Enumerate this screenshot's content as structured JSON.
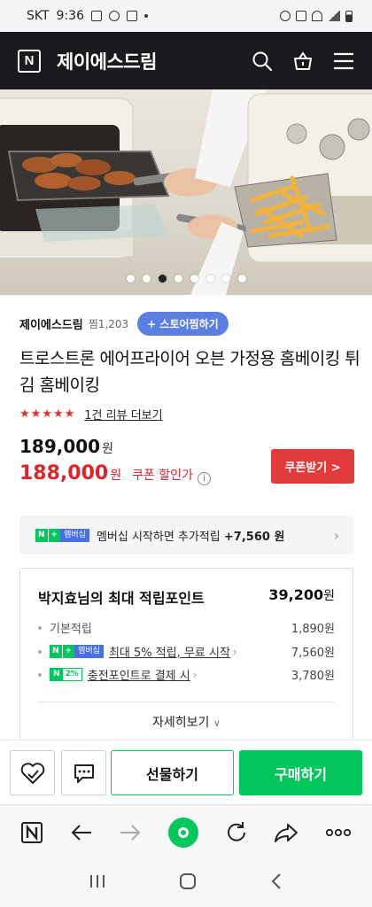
{
  "status_bar": {
    "carrier": "SKT",
    "time": "9:36"
  },
  "header": {
    "title": "제이에스드림",
    "logo_letter": "N"
  },
  "hero": {
    "slide_count": 8,
    "active_slide": 3
  },
  "product": {
    "store_name": "제이에스드림",
    "zzim": "찜1,203",
    "follow_label": "+ 스토어찜하기",
    "title": "트로스트론 에어프라이어 오븐 가정용 홈베이킹 튀김 홈베이킹",
    "stars": "★★★★★",
    "review_link": "1건 리뷰 더보기",
    "original_price": "189,000",
    "sale_price": "188,000",
    "won": "원",
    "coupon_label": "쿠폰 할인가",
    "coupon_button": "쿠폰받기 >"
  },
  "membership": {
    "badge_n": "N",
    "badge_plus": "+",
    "badge_mem": "멤버십",
    "text": "멤버십 시작하면 추가적립",
    "amount": "+7,560 원"
  },
  "points": {
    "title": "박지효님의 최대 적립포인트",
    "total": "39,200",
    "unit": "원",
    "rows": [
      {
        "label": "기본적립",
        "value": "1,890원"
      },
      {
        "label": "최대 5% 적립, 무료 시작",
        "value": "7,560원"
      },
      {
        "label": "충전포인트로 결제 시",
        "value": "3,780원"
      }
    ],
    "badge2_n": "N",
    "badge2_pct": "2%",
    "detail_label": "자세히보기"
  },
  "actions": {
    "gift_label": "선물하기",
    "buy_label": "구매하기"
  },
  "colors": {
    "naver_green": "#03c75a",
    "sale_red": "#e0232a",
    "header_dark": "#1b1b1f",
    "follow_blue": "#5b7fe0"
  }
}
